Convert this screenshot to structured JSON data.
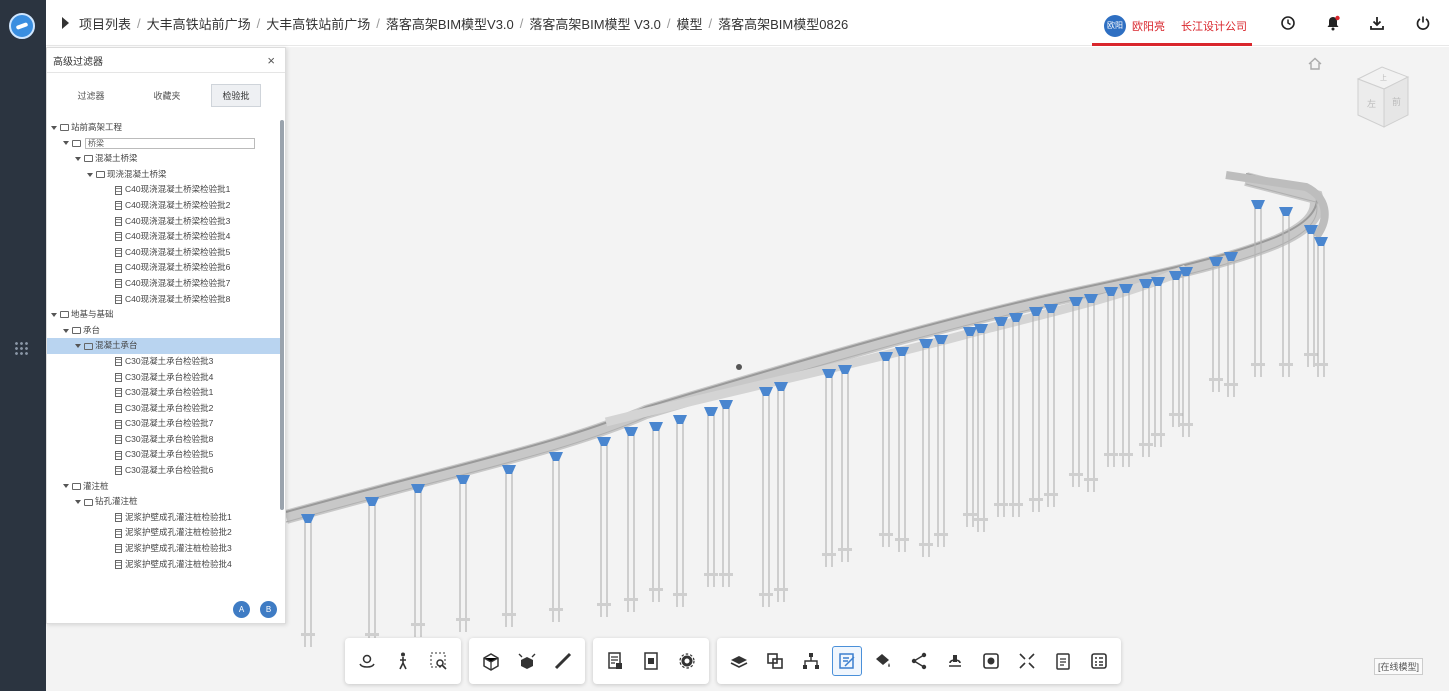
{
  "breadcrumb": {
    "items": [
      "项目列表",
      "大丰高铁站前广场",
      "大丰高铁站前广场",
      "落客高架BIM模型V3.0",
      "落客高架BIM模型 V3.0",
      "模型",
      "落客高架BIM模型0826"
    ],
    "separator": "/"
  },
  "user": {
    "avatar_text": "欧阳",
    "name": "欧阳亮",
    "company": "长江设计公司"
  },
  "header_icons": [
    "clock-icon",
    "bell-icon",
    "download-icon",
    "power-icon"
  ],
  "panel": {
    "title": "高级过滤器",
    "close": "×",
    "tabs": [
      "过滤器",
      "收藏夹",
      "检验批"
    ],
    "active_tab": 2,
    "tree": [
      {
        "level": 0,
        "type": "folder",
        "label": "站前高架工程"
      },
      {
        "level": 1,
        "type": "folder-input",
        "label": "桥梁"
      },
      {
        "level": 2,
        "type": "folder",
        "label": "混凝土桥梁"
      },
      {
        "level": 3,
        "type": "folder",
        "label": "现浇混凝土桥梁"
      },
      {
        "level": 4,
        "type": "doc",
        "label": "C40现浇混凝土桥梁检验批1"
      },
      {
        "level": 4,
        "type": "doc",
        "label": "C40现浇混凝土桥梁检验批2"
      },
      {
        "level": 4,
        "type": "doc",
        "label": "C40现浇混凝土桥梁检验批3"
      },
      {
        "level": 4,
        "type": "doc",
        "label": "C40现浇混凝土桥梁检验批4"
      },
      {
        "level": 4,
        "type": "doc",
        "label": "C40现浇混凝土桥梁检验批5"
      },
      {
        "level": 4,
        "type": "doc",
        "label": "C40现浇混凝土桥梁检验批6"
      },
      {
        "level": 4,
        "type": "doc",
        "label": "C40现浇混凝土桥梁检验批7"
      },
      {
        "level": 4,
        "type": "doc",
        "label": "C40现浇混凝土桥梁检验批8"
      },
      {
        "level": 0,
        "type": "folder",
        "label": "地基与基础"
      },
      {
        "level": 1,
        "type": "folder",
        "label": "承台"
      },
      {
        "level": 2,
        "type": "folder",
        "label": "混凝土承台",
        "selected": true
      },
      {
        "level": 4,
        "type": "doc",
        "label": "C30混凝土承台检验批3"
      },
      {
        "level": 4,
        "type": "doc",
        "label": "C30混凝土承台检验批4"
      },
      {
        "level": 4,
        "type": "doc",
        "label": "C30混凝土承台检验批1"
      },
      {
        "level": 4,
        "type": "doc",
        "label": "C30混凝土承台检验批2"
      },
      {
        "level": 4,
        "type": "doc",
        "label": "C30混凝土承台检验批7"
      },
      {
        "level": 4,
        "type": "doc",
        "label": "C30混凝土承台检验批8"
      },
      {
        "level": 4,
        "type": "doc",
        "label": "C30混凝土承台检验批5"
      },
      {
        "level": 4,
        "type": "doc",
        "label": "C30混凝土承台检验批6"
      },
      {
        "level": 1,
        "type": "folder",
        "label": "灌注桩"
      },
      {
        "level": 2,
        "type": "folder",
        "label": "钻孔灌注桩"
      },
      {
        "level": 4,
        "type": "doc",
        "label": "泥浆护壁成孔灌注桩检验批1"
      },
      {
        "level": 4,
        "type": "doc",
        "label": "泥浆护壁成孔灌注桩检验批2"
      },
      {
        "level": 4,
        "type": "doc",
        "label": "泥浆护壁成孔灌注桩检验批3"
      },
      {
        "level": 4,
        "type": "doc",
        "label": "泥浆护壁成孔灌注桩检验批4"
      }
    ],
    "bottom_buttons": [
      "A",
      "B"
    ]
  },
  "viewcube": {
    "left_face": "左",
    "front_face": "前",
    "top_face": "上"
  },
  "model_tag": "[在线模型]",
  "toolbar_groups": [
    [
      "orbit-icon",
      "walk-person-icon",
      "zoom-box-icon"
    ],
    [
      "section-box-icon",
      "explode-icon",
      "measure-icon"
    ],
    [
      "properties-icon",
      "model-info-icon",
      "settings-gear-icon"
    ],
    [
      "layers-icon",
      "copy-overlay-icon",
      "structure-tree-icon",
      "markup-edit-icon",
      "paint-bucket-icon",
      "share-icon",
      "hand-rotate-icon",
      "record-icon",
      "fullscreen-icon",
      "clipboard-icon",
      "checklist-icon"
    ]
  ],
  "toolbar_active": "markup-edit-icon",
  "colors": {
    "rail": "#2b3440",
    "accent_red": "#d9262c",
    "blue_cap": "#4a86cf",
    "selection": "#b9d4f0"
  }
}
